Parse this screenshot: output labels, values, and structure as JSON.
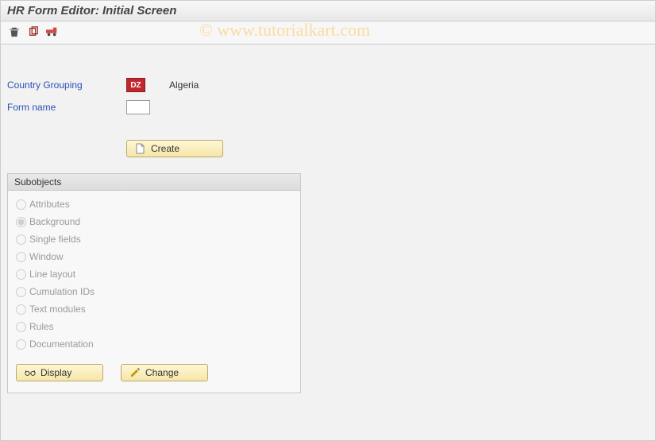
{
  "title": "HR Form Editor: Initial Screen",
  "watermark": "© www.tutorialkart.com",
  "fields": {
    "country_grouping": {
      "label": "Country Grouping",
      "value": "DZ",
      "display": "Algeria"
    },
    "form_name": {
      "label": "Form name",
      "value": ""
    }
  },
  "buttons": {
    "create": "Create",
    "display": "Display",
    "change": "Change"
  },
  "subobjects": {
    "title": "Subobjects",
    "items": [
      {
        "label": "Attributes",
        "selected": false
      },
      {
        "label": "Background",
        "selected": true
      },
      {
        "label": "Single fields",
        "selected": false
      },
      {
        "label": "Window",
        "selected": false
      },
      {
        "label": "Line layout",
        "selected": false
      },
      {
        "label": "Cumulation IDs",
        "selected": false
      },
      {
        "label": "Text modules",
        "selected": false
      },
      {
        "label": "Rules",
        "selected": false
      },
      {
        "label": "Documentation",
        "selected": false
      }
    ]
  }
}
